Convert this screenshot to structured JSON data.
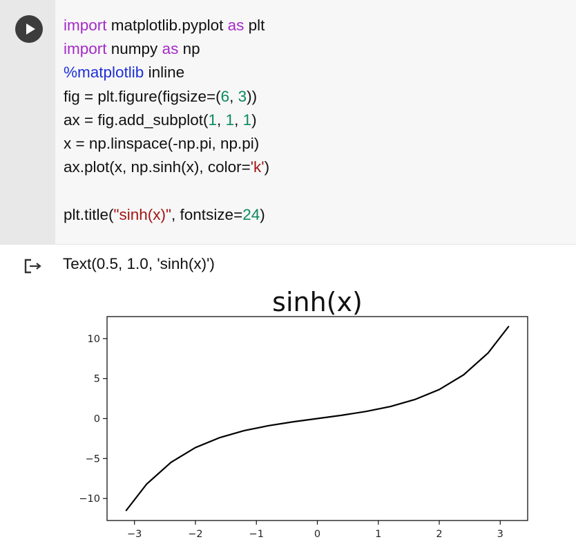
{
  "run_button": {
    "icon": "play-icon"
  },
  "code_lines": [
    [
      {
        "t": "import",
        "c": "kw"
      },
      {
        "t": " matplotlib.pyplot ",
        "c": ""
      },
      {
        "t": "as",
        "c": "kw"
      },
      {
        "t": " plt",
        "c": ""
      }
    ],
    [
      {
        "t": "import",
        "c": "kw"
      },
      {
        "t": " numpy ",
        "c": ""
      },
      {
        "t": "as",
        "c": "kw"
      },
      {
        "t": " np",
        "c": ""
      }
    ],
    [
      {
        "t": "%matplotlib",
        "c": "magic"
      },
      {
        "t": " inline",
        "c": ""
      }
    ],
    [
      {
        "t": "fig = plt.figure(figsize=(",
        "c": ""
      },
      {
        "t": "6",
        "c": "num"
      },
      {
        "t": ", ",
        "c": ""
      },
      {
        "t": "3",
        "c": "num"
      },
      {
        "t": "))",
        "c": ""
      }
    ],
    [
      {
        "t": "ax = fig.add_subplot(",
        "c": ""
      },
      {
        "t": "1",
        "c": "num"
      },
      {
        "t": ", ",
        "c": ""
      },
      {
        "t": "1",
        "c": "num"
      },
      {
        "t": ", ",
        "c": ""
      },
      {
        "t": "1",
        "c": "num"
      },
      {
        "t": ")",
        "c": ""
      }
    ],
    [
      {
        "t": "x = np.linspace(-np.pi, np.pi)",
        "c": ""
      }
    ],
    [
      {
        "t": "ax.plot(x, np.sinh(x), color=",
        "c": ""
      },
      {
        "t": "'k'",
        "c": "str"
      },
      {
        "t": ")",
        "c": ""
      }
    ],
    [],
    [
      {
        "t": "plt.title(",
        "c": ""
      },
      {
        "t": "\"sinh(x)\"",
        "c": "str"
      },
      {
        "t": ", fontsize=",
        "c": ""
      },
      {
        "t": "24",
        "c": "num"
      },
      {
        "t": ")",
        "c": ""
      }
    ]
  ],
  "output": {
    "icon": "output-arrow-icon",
    "text": "Text(0.5, 1.0, 'sinh(x)')"
  },
  "chart_data": {
    "type": "line",
    "title": "sinh(x)",
    "xlabel": "",
    "ylabel": "",
    "xlim": [
      -3.45,
      3.45
    ],
    "ylim": [
      -12.75,
      12.75
    ],
    "xticks": [
      -3,
      -2,
      -1,
      0,
      1,
      2,
      3
    ],
    "xtick_labels": [
      "−3",
      "−2",
      "−1",
      "0",
      "1",
      "2",
      "3"
    ],
    "yticks": [
      -10,
      -5,
      0,
      5,
      10
    ],
    "ytick_labels": [
      "−10",
      "−5",
      "0",
      "5",
      "10"
    ],
    "grid": false,
    "line_color": "#000000",
    "series": [
      {
        "x": [
          -3.1416,
          -2.8,
          -2.4,
          -2.0,
          -1.6,
          -1.2,
          -0.8,
          -0.4,
          0.0,
          0.4,
          0.8,
          1.2,
          1.6,
          2.0,
          2.4,
          2.8,
          3.1416
        ],
        "values": [
          -11.55,
          -8.19,
          -5.47,
          -3.63,
          -2.38,
          -1.51,
          -0.89,
          -0.41,
          0.0,
          0.41,
          0.89,
          1.51,
          2.38,
          3.63,
          5.47,
          8.19,
          11.55
        ]
      }
    ]
  }
}
